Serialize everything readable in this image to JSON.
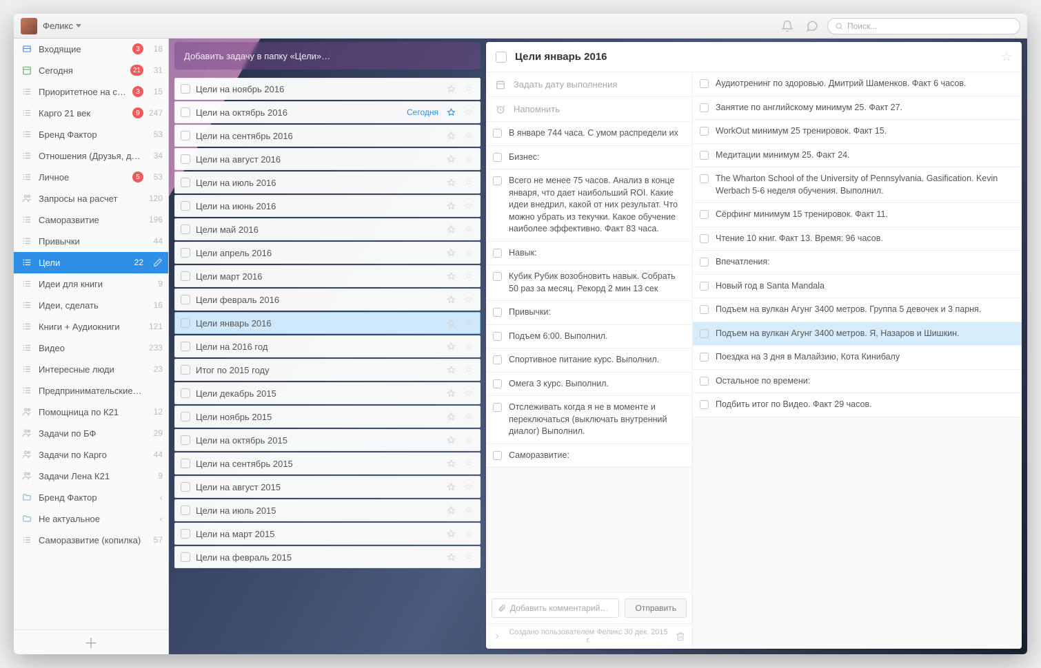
{
  "user": {
    "name": "Феликс"
  },
  "search": {
    "placeholder": "Поиск..."
  },
  "sidebar": {
    "items": [
      {
        "icon": "inbox",
        "label": "Входящие",
        "badge": "3",
        "count": "18"
      },
      {
        "icon": "today",
        "label": "Сегодня",
        "badge": "21",
        "count": "31"
      },
      {
        "icon": "list",
        "label": "Приоритетное на с…",
        "badge": "3",
        "count": "15"
      },
      {
        "icon": "list",
        "label": "Карго 21 век",
        "badge": "9",
        "count": "247"
      },
      {
        "icon": "list",
        "label": "Бренд Фактор",
        "count": "53"
      },
      {
        "icon": "list",
        "label": "Отношения (Друзья, д…",
        "count": "34"
      },
      {
        "icon": "list",
        "label": "Личное",
        "badge": "5",
        "count": "53"
      },
      {
        "icon": "people",
        "label": "Запросы на расчет",
        "count": "120",
        "shared": true
      },
      {
        "icon": "list",
        "label": "Саморазвитие",
        "count": "196"
      },
      {
        "icon": "list",
        "label": "Привычки",
        "count": "44"
      },
      {
        "icon": "list",
        "label": "Цели",
        "count": "22",
        "active": true
      },
      {
        "icon": "list",
        "label": "Идеи для книги",
        "count": "9"
      },
      {
        "icon": "list",
        "label": "Идеи, сделать",
        "count": "16"
      },
      {
        "icon": "list",
        "label": "Книги + Аудиокниги",
        "count": "121"
      },
      {
        "icon": "list",
        "label": "Видео",
        "count": "233"
      },
      {
        "icon": "list",
        "label": "Интересные люди",
        "count": "23"
      },
      {
        "icon": "list",
        "label": "Предпринимательские…"
      },
      {
        "icon": "people",
        "label": "Помощница по К21",
        "count": "12"
      },
      {
        "icon": "people",
        "label": "Задачи по БФ",
        "count": "29"
      },
      {
        "icon": "people",
        "label": "Задачи по Карго",
        "count": "44"
      },
      {
        "icon": "people",
        "label": "Задачи Лена К21",
        "count": "9"
      },
      {
        "icon": "folder",
        "label": "Бренд Фактор",
        "chev": true
      },
      {
        "icon": "folder",
        "label": "Не актуальное",
        "chev": true
      },
      {
        "icon": "list",
        "label": "Саморазвитие (копилка)",
        "count": "57"
      }
    ]
  },
  "list": {
    "add_placeholder": "Добавить задачу в папку «Цели»…",
    "tasks": [
      {
        "title": "Цели на ноябрь 2016"
      },
      {
        "title": "Цели на октябрь 2016",
        "today": "Сегодня"
      },
      {
        "title": "Цели на сентябрь 2016"
      },
      {
        "title": "Цели на август 2016"
      },
      {
        "title": "Цели на июль 2016"
      },
      {
        "title": "Цели на июнь 2016"
      },
      {
        "title": "Цели май 2016"
      },
      {
        "title": "Цели апрель 2016"
      },
      {
        "title": "Цели март 2016"
      },
      {
        "title": "Цели февраль 2016"
      },
      {
        "title": "Цели январь 2016",
        "selected": true
      },
      {
        "title": "Цели на 2016 год"
      },
      {
        "title": "Итог по 2015 году"
      },
      {
        "title": "Цели декабрь 2015"
      },
      {
        "title": "Цели ноябрь 2015"
      },
      {
        "title": "Цели на октябрь 2015"
      },
      {
        "title": "Цели на сентябрь 2015"
      },
      {
        "title": "Цели на август 2015"
      },
      {
        "title": "Цели на июль 2015"
      },
      {
        "title": "Цели на март 2015"
      },
      {
        "title": "Цели на февраль 2015"
      }
    ]
  },
  "detail": {
    "title": "Цели январь 2016",
    "date_placeholder": "Задать дату выполнения",
    "remind_placeholder": "Напомнить",
    "subtasks_left": [
      "В январе 744 часа. С умом распредели их",
      "Бизнес:",
      "Всего не менее 75 часов. Анализ в конце января, что дает наибольший ROI. Какие идеи внедрил, какой от них результат. Что можно убрать из текучки. Какое обучение наиболее эффективно. Факт 83 часа.",
      "Навык:",
      "Кубик Рубик возобновить навык. Собрать 50 раз за месяц. Рекорд 2 мин 13 сек",
      "Привычки:",
      "Подъем 6:00. Выполнил.",
      "Спортивное питание курс. Выполнил.",
      "Омега 3 курс. Выполнил.",
      "Отслеживать когда я не в моменте и переключаться (выключать внутренний диалог) Выполнил.",
      "Саморазвитие:"
    ],
    "subtasks_right": [
      {
        "t": "Аудиотренинг по здоровью. Дмитрий Шаменков. Факт 6 часов."
      },
      {
        "t": "Занятие по английскому минимум 25. Факт 27."
      },
      {
        "t": "WorkOut минимум 25 тренировок. Факт 15."
      },
      {
        "t": "Медитации минимум 25. Факт 24."
      },
      {
        "t": "The Wharton School of the University of Pennsylvania. Gasification.  Kevin Werbach 5-6 неделя обучения. Выполнил."
      },
      {
        "t": "Сёрфинг минимум 15 тренировок. Факт 11."
      },
      {
        "t": "Чтение 10 книг. Факт 13. Время: 96 часов."
      },
      {
        "t": "Впечатления:"
      },
      {
        "t": "Новый год в Santa Mandala"
      },
      {
        "t": "Подъем на вулкан Агунг 3400 метров. Группа 5 девочек и 3 парня."
      },
      {
        "t": "Подъем на вулкан Агунг 3400 метров. Я, Назаров и Шишкин.",
        "sel": true
      },
      {
        "t": "Поездка на 3 дня в Малайзию, Кота Кинибалу"
      },
      {
        "t": "Остальное по времени:"
      },
      {
        "t": "Подбить итог по Видео. Факт 29 часов."
      }
    ],
    "comment_placeholder": "Добавить комментарий…",
    "send_label": "Отправить",
    "created": "Создано пользователем Феликс 30 дек. 2015 г."
  }
}
